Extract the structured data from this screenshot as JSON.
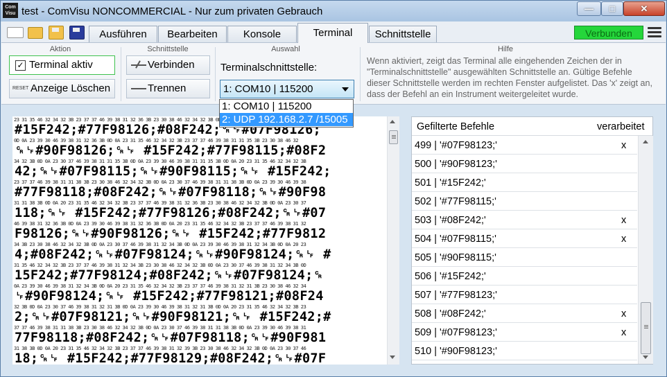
{
  "window": {
    "title": "test - ComVisu NONCOMMERCIAL - Nur zum privaten Gebrauch",
    "logo_text": "Com Visu",
    "min_glyph": "—",
    "max_glyph": "□",
    "close_glyph": "✕"
  },
  "tabs": [
    {
      "label": "Ausführen",
      "active": false
    },
    {
      "label": "Bearbeiten",
      "active": false
    },
    {
      "label": "Konsole",
      "active": false
    },
    {
      "label": "Terminal",
      "active": true
    },
    {
      "label": "Schnittstelle",
      "active": false
    }
  ],
  "status": {
    "label": "Verbunden",
    "color": "#25d63b"
  },
  "ribbon": {
    "aktion": {
      "title": "Aktion",
      "terminal_aktiv": {
        "label": "Terminal aktiv",
        "checked": true,
        "check_glyph": "✓"
      },
      "anzeige_loeschen": {
        "label": "Anzeige Löschen",
        "icon_text": "RESET"
      }
    },
    "schnittstelle": {
      "title": "Schnittstelle",
      "verbinden": "Verbinden",
      "trennen": "Trennen"
    },
    "auswahl": {
      "title": "Auswahl",
      "label": "Terminalschnittstelle:",
      "selected": "1: COM10 | 115200",
      "options": [
        "1: COM10 | 115200",
        "2: UDP 192.168.2.7 /15005"
      ],
      "highlighted_option": 1
    },
    "hilfe": {
      "title": "Hilfe",
      "text": "Wenn aktiviert, zeigt das Terminal alle eingehenden Zeichen der in \"Terminalschnittstelle\" ausgewählten Schnittstelle an. Gültige Befehle dieser Schnittstelle werden im rechten Fenster aufgelistet. Das 'x' zeigt an, dass der Befehl an ein Instrument weitergeleitet wurde."
    }
  },
  "terminal": {
    "lines": [
      {
        "hex": "23 31 35 46 32 34 32 3B 23 37 37 46 39 38 31 32 36 3B 23 30 38 46 32 34 32 3B 0D 0A 23 30 37 46 39 38 31 32 36 3B",
        "chars": "#15F242;#77F98126;#08F242;␍␊#07F98126;"
      },
      {
        "hex": "0D 0A 23 39 30 46 39 38 31 32 36 3B 0D 0A 23 31 35 46 32 34 32 3B 23 37 37 46 39 38 31 31 35 3B 23 30 38 46 32",
        "chars": "␍␊#90F98126;␍␊ #15F242;#77F98115;#08F2"
      },
      {
        "hex": "34 32 3B 0D 0A 23 30 37 46 39 38 31 31 35 3B 0D 0A 23 39 30 46 39 38 31 31 35 3B 0D 0A 20 23 31 35 46 32 34 32 3B",
        "chars": "42;␍␊#07F98115;␍␊#90F98115;␍␊ #15F242;"
      },
      {
        "hex": "23 37 37 46 39 38 31 31 38 3B 23 30 38 46 32 34 32 3B 0D 0A 23 30 37 46 39 38 31 31 38 3B 0D 0A 23 39 30 46 39 38",
        "chars": "#77F98118;#08F242;␍␊#07F98118;␍␊#90F98"
      },
      {
        "hex": "31 31 38 3B 0D 0A 20 23 31 35 46 32 34 32 3B 23 37 37 46 39 38 31 32 36 3B 23 30 38 46 32 34 32 3B 0D 0A 23 30 37",
        "chars": "118;␍␊ #15F242;#77F98126;#08F242;␍␊#07"
      },
      {
        "hex": "46 39 38 31 32 36 3B 0D 0A 23 39 30 46 39 38 31 32 36 3B 0D 0A 20 23 31 35 46 32 34 32 3B 23 37 37 46 39 38 31 32",
        "chars": "F98126;␍␊#90F98126;␍␊ #15F242;#77F9812"
      },
      {
        "hex": "34 3B 23 30 38 46 32 34 32 3B 0D 0A 23 30 37 46 39 38 31 32 34 3B 0D 0A 23 39 30 46 39 38 31 32 34 3B 0D 0A 20 23",
        "chars": "4;#08F242;␍␊#07F98124;␍␊#90F98124;␍␊ #"
      },
      {
        "hex": "31 35 46 32 34 32 3B 23 37 37 46 39 38 31 32 34 3B 23 30 38 46 32 34 32 3B 0D 0A 23 30 37 46 39 38 31 32 34 3B 0D",
        "chars": "15F242;#77F98124;#08F242;␍␊#07F98124;␍"
      },
      {
        "hex": "0A 23 39 30 46 39 38 31 32 34 3B 0D 0A 20 23 31 35 46 32 34 32 3B 23 37 37 46 39 38 31 32 31 3B 23 30 38 46 32 34",
        "chars": "␊#90F98124;␍␊ #15F242;#77F98121;#08F24"
      },
      {
        "hex": "32 3B 0D 0A 23 30 37 46 39 38 31 32 31 3B 0D 0A 23 39 30 46 39 38 31 32 31 3B 0D 0A 20 23 31 35 46 32 34 32 3B 23",
        "chars": "2;␍␊#07F98121;␍␊#90F98121;␍␊ #15F242;#"
      },
      {
        "hex": "37 37 46 39 38 31 31 38 3B 23 30 38 46 32 34 32 3B 0D 0A 23 30 37 46 39 38 31 31 38 3B 0D 0A 23 39 30 46 39 38 31",
        "chars": "77F98118;#08F242;␍␊#07F98118;␍␊#90F981"
      },
      {
        "hex": "31 38 3B 0D 0A 20 23 31 35 46 32 34 32 3B 23 37 37 46 39 38 31 32 39 3B 23 30 38 46 32 34 32 3B 0D 0A 23 30 37 46",
        "chars": "18;␍␊ #15F242;#77F98129;#08F242;␍␊#07F"
      }
    ]
  },
  "commands": {
    "header_left": "Gefilterte Befehle",
    "header_right": "verarbeitet",
    "rows": [
      {
        "text": "499 | '#07F98123;'",
        "mark": "x"
      },
      {
        "text": "500 | '#90F98123;'",
        "mark": ""
      },
      {
        "text": "501 | '#15F242;'",
        "mark": ""
      },
      {
        "text": "502 | '#77F98115;'",
        "mark": ""
      },
      {
        "text": "503 | '#08F242;'",
        "mark": "x"
      },
      {
        "text": "504 | '#07F98115;'",
        "mark": "x"
      },
      {
        "text": "505 | '#90F98115;'",
        "mark": ""
      },
      {
        "text": "506 | '#15F242;'",
        "mark": ""
      },
      {
        "text": "507 | '#77F98123;'",
        "mark": ""
      },
      {
        "text": "508 | '#08F242;'",
        "mark": "x"
      },
      {
        "text": "509 | '#07F98123;'",
        "mark": "x"
      },
      {
        "text": "510 | '#90F98123;'",
        "mark": ""
      }
    ]
  }
}
